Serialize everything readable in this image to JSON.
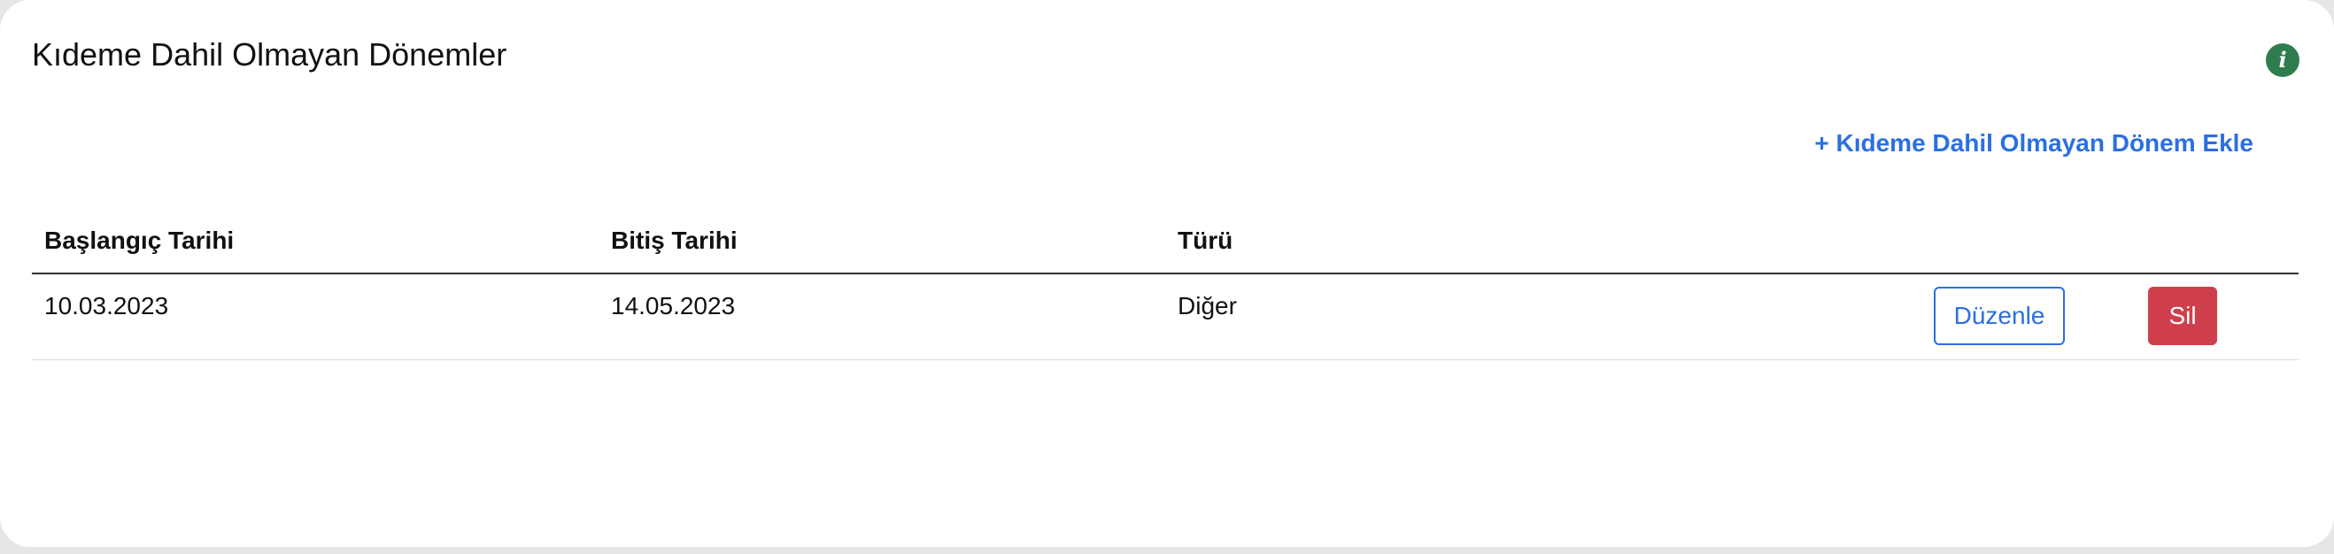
{
  "section": {
    "title": "Kıdeme Dahil Olmayan Dönemler",
    "info_icon": "info-icon",
    "add_link_label": "+ Kıdeme Dahil Olmayan Dönem Ekle"
  },
  "table": {
    "columns": [
      "Başlangıç Tarihi",
      "Bitiş Tarihi",
      "Türü"
    ],
    "rows": [
      {
        "start_date": "10.03.2023",
        "end_date": "14.05.2023",
        "type": "Diğer",
        "edit_label": "Düzenle",
        "delete_label": "Sil"
      }
    ]
  },
  "colors": {
    "accent_blue": "#2b6fe0",
    "delete_red": "#cf3f4b",
    "info_green": "#2e7d4f"
  }
}
